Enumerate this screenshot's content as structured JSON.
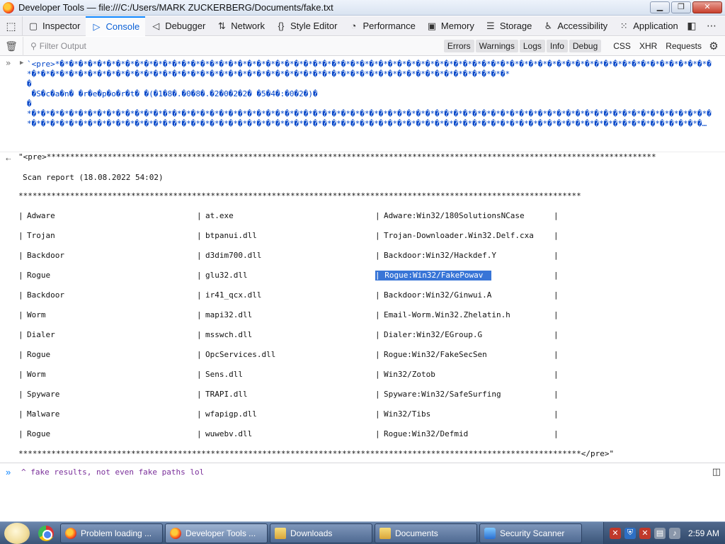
{
  "window": {
    "title": "Developer Tools — file:///C:/Users/MARK ZUCKERBERG/Documents/fake.txt"
  },
  "devtools": {
    "tabs": [
      {
        "label": "Inspector",
        "icon": "inspector-icon"
      },
      {
        "label": "Console",
        "icon": "console-icon"
      },
      {
        "label": "Debugger",
        "icon": "debugger-icon"
      },
      {
        "label": "Network",
        "icon": "network-icon"
      },
      {
        "label": "Style Editor",
        "icon": "style-editor-icon"
      },
      {
        "label": "Performance",
        "icon": "performance-icon"
      },
      {
        "label": "Memory",
        "icon": "memory-icon"
      },
      {
        "label": "Storage",
        "icon": "storage-icon"
      },
      {
        "label": "Accessibility",
        "icon": "accessibility-icon"
      },
      {
        "label": "Application",
        "icon": "application-icon"
      }
    ],
    "active_tab": "Console"
  },
  "filterbar": {
    "placeholder": "Filter Output",
    "levels": [
      "Errors",
      "Warnings",
      "Logs",
      "Info",
      "Debug"
    ],
    "extra": [
      "CSS",
      "XHR",
      "Requests"
    ]
  },
  "console": {
    "input_code": "`<pre>*�*�*�*�*�*�*�*�*�*�*�*�*�*�*�*�*�*�*�*�*�*�*�*�*�*�*�*�*�*�*�*�*�*�*�*�*�*�*�*�*�*�*�*�*�*�*�*�*�*�*�*�*�*�*�*�*�*�*�*�*�*�*�*�*�*�*�*�*�*�*�*�*�*�*�*�*�*�*�*�*�*�*�*�*�*�*�*�*�*�*�*�*�*�*�*�*�*�*�*�*�*�*�*�*�*�*�*�*�*�*�*�*�*�*�*�*�*�*�*�*�*\n�\n �S�c�a�n� �r�e�p�o�r�t� �(�1�8�.�0�8�.�2�0�2�2� �5�4�:�0�2�)�\n�\n*�*�*�*�*�*�*�*�*�*�*�*�*�*�*�*�*�*�*�*�*�*�*�*�*�*�*�*�*�*�*�*�*�*�*�*�*�*�*�*�*�*�*�*�*�*�*�*�*�*�*�*�*�*�*�*�*�*�*�*�*�*�*�*�*�*�*�*�*�*�*�*�*�*�*�*�*�*�*�*�*�*�*�*�*�*�*�*�*�*�*�*�*�*�*�*�*�*�*�*�*�*�*�*�*�*�*�*�*�*�*�*�*�*�*�*�*�*�*�*�*�*�*�*�*�*�*�*�*�*�*�*�*�*�*�*�*�*�*�*�*�*�*�*�*�…",
    "output_first": "\"<pre>**********************************************************************************************************************************",
    "scan_title": "Scan report (18.08.2022 54:02)",
    "separator": "************************************************************************************************************************",
    "closing_line": "************************************************************************************************************************</pre>\"",
    "rows": [
      {
        "category": "Adware",
        "file": "at.exe",
        "threat": "Adware:Win32/180SolutionsNCase"
      },
      {
        "category": "Trojan",
        "file": "btpanui.dll",
        "threat": "Trojan-Downloader.Win32.Delf.cxa"
      },
      {
        "category": "Backdoor",
        "file": "d3dim700.dll",
        "threat": "Backdoor:Win32/Hackdef.Y"
      },
      {
        "category": "Rogue",
        "file": "glu32.dll",
        "threat": "Rogue:Win32/FakePowav"
      },
      {
        "category": "Backdoor",
        "file": "ir41_qcx.dll",
        "threat": "Backdoor:Win32/Ginwui.A"
      },
      {
        "category": "Worm",
        "file": "mapi32.dll",
        "threat": "Email-Worm.Win32.Zhelatin.h"
      },
      {
        "category": "Dialer",
        "file": "msswch.dll",
        "threat": "Dialer:Win32/EGroup.G"
      },
      {
        "category": "Rogue",
        "file": "OpcServices.dll",
        "threat": "Rogue:Win32/FakeSecSen"
      },
      {
        "category": "Worm",
        "file": "Sens.dll",
        "threat": "Win32/Zotob"
      },
      {
        "category": "Spyware",
        "file": "TRAPI.dll",
        "threat": "Spyware:Win32/SafeSurfing"
      },
      {
        "category": "Malware",
        "file": "wfapigp.dll",
        "threat": "Win32/Tibs"
      },
      {
        "category": "Rogue",
        "file": "wuwebv.dll",
        "threat": "Rogue:Win32/Defmid"
      }
    ],
    "highlighted_row": 3,
    "command": "^ fake results, not even fake paths lol"
  },
  "taskbar": {
    "tasks": [
      {
        "label": "Problem loading ...",
        "icon": "firefox-icon"
      },
      {
        "label": "Developer Tools ...",
        "icon": "firefox-icon"
      },
      {
        "label": "Downloads",
        "icon": "folder-icon"
      },
      {
        "label": "Documents",
        "icon": "folder-icon"
      },
      {
        "label": "Security Scanner",
        "icon": "shield-icon"
      }
    ],
    "clock": "2:59 AM"
  },
  "colors": {
    "accent": "#0a84ff",
    "code_blue": "#0044c8",
    "selection": "#3875d7",
    "command_purple": "#7a2f9a"
  }
}
